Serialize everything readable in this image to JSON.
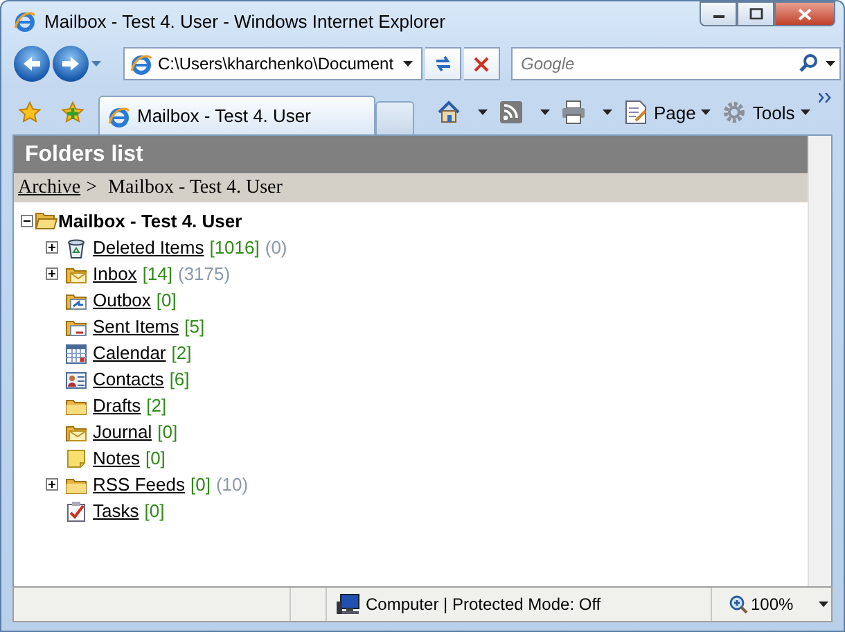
{
  "window": {
    "title": "Mailbox - Test 4. User - Windows Internet Explorer"
  },
  "address_bar": {
    "value": "C:\\Users\\kharchenko\\Document"
  },
  "search": {
    "placeholder": "Google"
  },
  "tabs": [
    {
      "label": "Mailbox - Test 4. User",
      "selected": true
    }
  ],
  "command_bar": [
    {
      "kind": "home"
    },
    {
      "kind": "feeds"
    },
    {
      "kind": "print"
    },
    {
      "kind": "page",
      "label": "Page"
    },
    {
      "kind": "tools",
      "label": "Tools"
    }
  ],
  "panel": {
    "title": "Folders list"
  },
  "breadcrumb": {
    "link": "Archive",
    "separator": ">",
    "current": "Mailbox - Test 4. User"
  },
  "tree": {
    "label": "Mailbox - Test 4. User",
    "expanded": true,
    "children": [
      {
        "kind": "trash",
        "label": "Deleted Items",
        "count": "[1016]",
        "total": "(0)",
        "expandable": true
      },
      {
        "kind": "inbox",
        "label": "Inbox",
        "count": "[14]",
        "total": "(3175)",
        "expandable": true
      },
      {
        "kind": "outbox",
        "label": "Outbox",
        "count": "[0]",
        "expandable": false
      },
      {
        "kind": "sent",
        "label": "Sent Items",
        "count": "[5]",
        "expandable": false
      },
      {
        "kind": "calendar",
        "label": "Calendar",
        "count": "[2]",
        "expandable": false
      },
      {
        "kind": "contacts",
        "label": "Contacts",
        "count": "[6]",
        "expandable": false
      },
      {
        "kind": "folder",
        "label": "Drafts",
        "count": "[2]",
        "expandable": false
      },
      {
        "kind": "journal",
        "label": "Journal",
        "count": "[0]",
        "expandable": false
      },
      {
        "kind": "notes",
        "label": "Notes",
        "count": "[0]",
        "expandable": false
      },
      {
        "kind": "folder",
        "label": "RSS Feeds",
        "count": "[0]",
        "total": "(10)",
        "expandable": true
      },
      {
        "kind": "tasks",
        "label": "Tasks",
        "count": "[0]",
        "expandable": false
      }
    ]
  },
  "status_bar": {
    "zone": "Computer | Protected Mode: Off",
    "zoom": "100%"
  }
}
